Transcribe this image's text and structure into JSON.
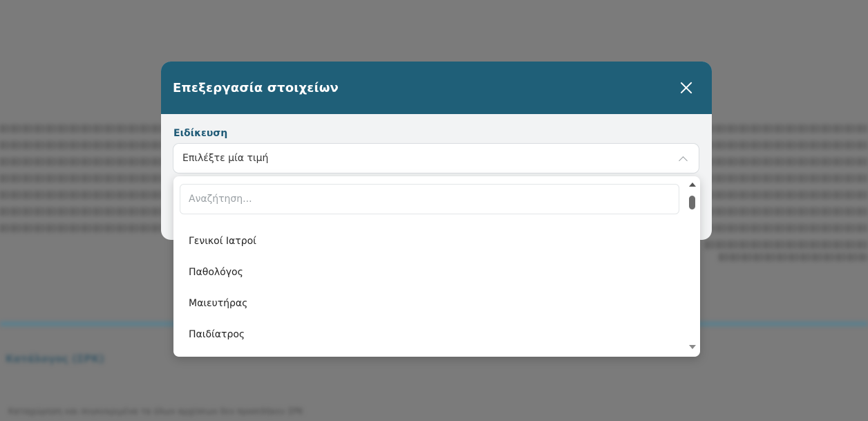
{
  "modal": {
    "title": "Επεξεργασία στοιχείων",
    "field_label": "Ειδίκευση",
    "select_value": "Επιλέξτε μία τιμή"
  },
  "dropdown": {
    "search_placeholder": "Αναζήτηση...",
    "options": [
      "Γενικοί Ιατροί",
      "Παθολόγος",
      "Μαιευτήρας",
      "Παιδίατρος"
    ]
  },
  "background": {
    "heading": "Κατάλογος (ΣΡΚ)",
    "text": "Καταχώρηση και συγκεκριμένα τα όλων αρχίσεων δεν προσιδήκευ ΣΡΚ"
  },
  "colors": {
    "header": "#1f5f78",
    "label": "#1f5a76",
    "overlay": "#7b7b7b"
  }
}
